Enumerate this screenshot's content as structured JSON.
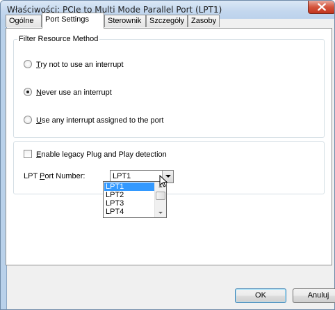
{
  "window": {
    "title": "Właściwości: PCIe to Multi Mode Parallel Port (LPT1)",
    "close_icon": "close-icon"
  },
  "tabs": [
    {
      "label": "Ogólne",
      "active": false
    },
    {
      "label": "Port Settings",
      "active": true
    },
    {
      "label": "Sterownik",
      "active": false
    },
    {
      "label": "Szczegóły",
      "active": false
    },
    {
      "label": "Zasoby",
      "active": false
    }
  ],
  "filter": {
    "legend": "Filter Resource Method",
    "options": [
      {
        "underline": "T",
        "rest": "ry not to use an interrupt",
        "checked": false
      },
      {
        "underline": "N",
        "rest": "ever use an interrupt",
        "checked": true
      },
      {
        "underline": "U",
        "rest": "se any interrupt assigned to the port",
        "checked": false
      }
    ]
  },
  "legacy": {
    "underline": "E",
    "rest": "nable legacy Plug and Play detection",
    "checked": false
  },
  "port": {
    "label_pre": "LPT ",
    "label_underline": "P",
    "label_post": "ort Number:",
    "selected": "LPT1",
    "options": [
      "LPT1",
      "LPT2",
      "LPT3",
      "LPT4"
    ]
  },
  "buttons": {
    "ok": "OK",
    "cancel": "Anuluj"
  },
  "colors": {
    "selection": "#3399ff",
    "close": "#c2351e"
  }
}
